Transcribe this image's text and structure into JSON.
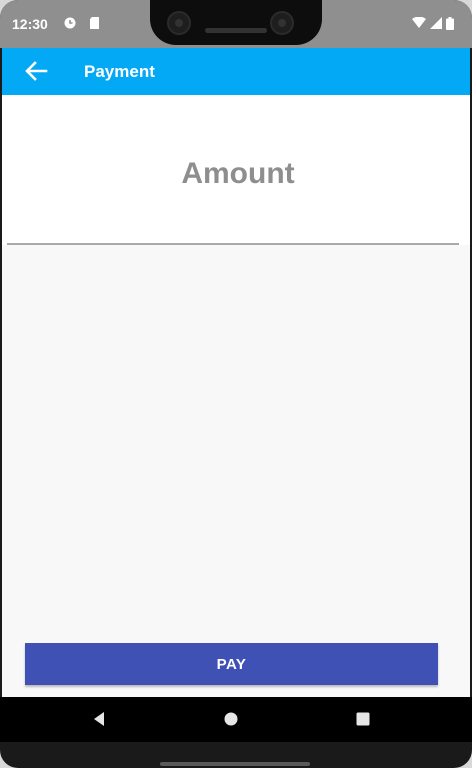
{
  "status_bar": {
    "time": "12:30",
    "left_icons": [
      "sync-icon",
      "sim-card-icon"
    ],
    "right_icons": [
      "wifi-icon",
      "cell-signal-icon",
      "battery-icon"
    ]
  },
  "app_bar": {
    "title": "Payment",
    "back_icon": "arrow-back-icon",
    "color": "#03a9f4"
  },
  "form": {
    "amount_placeholder": "Amount",
    "amount_value": ""
  },
  "actions": {
    "pay_label": "PAY",
    "pay_color": "#3f51b5"
  },
  "nav_bar": {
    "buttons": [
      "back-nav-icon",
      "home-nav-icon",
      "recents-nav-icon"
    ]
  }
}
